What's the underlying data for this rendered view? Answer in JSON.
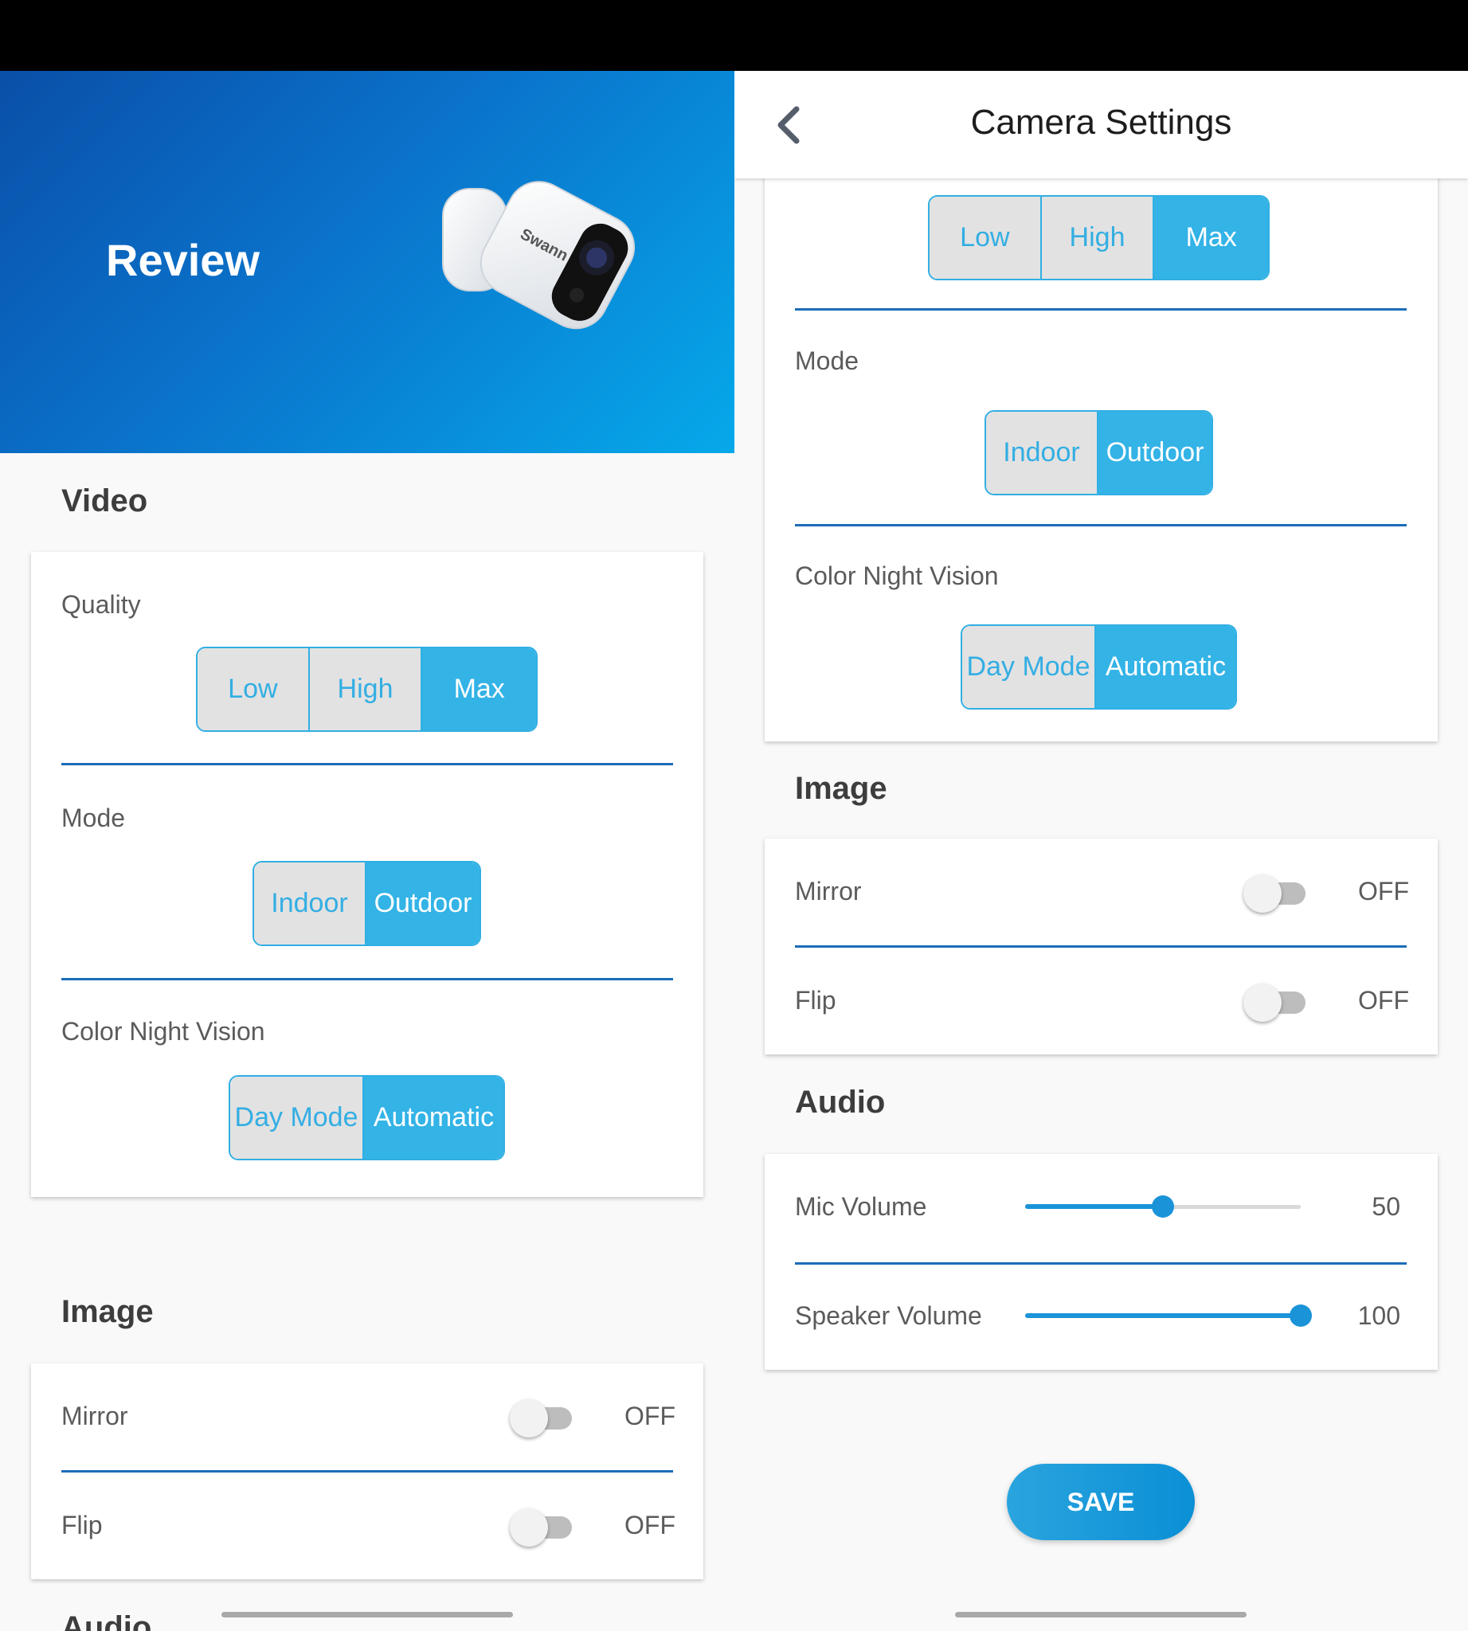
{
  "left": {
    "hero_title": "Review",
    "camera_brand": "Swann",
    "video": {
      "title": "Video",
      "quality": {
        "label": "Quality",
        "options": [
          "Low",
          "High",
          "Max"
        ],
        "selected": "Max"
      },
      "mode": {
        "label": "Mode",
        "options": [
          "Indoor",
          "Outdoor"
        ],
        "selected": "Outdoor"
      },
      "night_vision": {
        "label": "Color Night Vision",
        "options": [
          "Day Mode",
          "Automatic"
        ],
        "selected": "Automatic"
      }
    },
    "image": {
      "title": "Image",
      "mirror": {
        "label": "Mirror",
        "state": "OFF"
      },
      "flip": {
        "label": "Flip",
        "state": "OFF"
      }
    },
    "audio": {
      "title": "Audio"
    }
  },
  "right": {
    "header": {
      "title": "Camera Settings",
      "back_icon": "chevron-left-icon"
    },
    "video": {
      "quality": {
        "options": [
          "Low",
          "High",
          "Max"
        ],
        "selected": "Max"
      },
      "mode": {
        "label": "Mode",
        "options": [
          "Indoor",
          "Outdoor"
        ],
        "selected": "Outdoor"
      },
      "night_vision": {
        "label": "Color Night Vision",
        "options": [
          "Day Mode",
          "Automatic"
        ],
        "selected": "Automatic"
      }
    },
    "image": {
      "title": "Image",
      "mirror": {
        "label": "Mirror",
        "state": "OFF"
      },
      "flip": {
        "label": "Flip",
        "state": "OFF"
      }
    },
    "audio": {
      "title": "Audio",
      "mic": {
        "label": "Mic Volume",
        "value": "50"
      },
      "speaker": {
        "label": "Speaker Volume",
        "value": "100"
      }
    },
    "save_label": "SAVE"
  },
  "colors": {
    "accent": "#33b3e6",
    "divider": "#1c6cb8",
    "slider": "#1b93d8"
  }
}
